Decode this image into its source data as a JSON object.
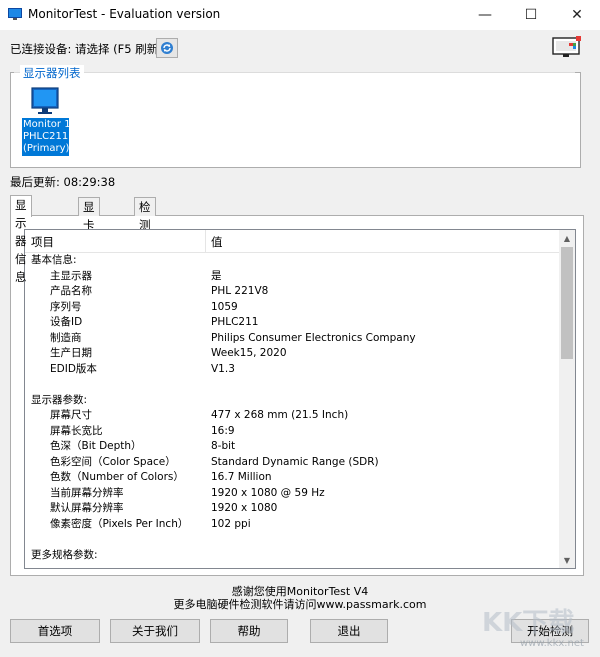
{
  "window": {
    "title": "MonitorTest - Evaluation version",
    "minimize_glyph": "—",
    "maximize_glyph": "☐",
    "close_glyph": "✕"
  },
  "status": {
    "connected_device_text": "已连接设备: 请选择 (F5 刷新)",
    "last_update_label": "最后更新:",
    "last_update_time": "08:29:38"
  },
  "monitor_list": {
    "legend": "显示器列表",
    "monitor": {
      "name": "Monitor 1",
      "model": "PHLC211",
      "role": "(Primary)"
    }
  },
  "tabs": [
    {
      "label": "显示器信息",
      "active": true
    },
    {
      "label": "显卡信息",
      "active": false
    },
    {
      "label": "检测选项",
      "active": false
    }
  ],
  "table": {
    "col_item": "项目",
    "col_value": "值",
    "rows": [
      {
        "k": "基本信息:",
        "v": "",
        "section": true
      },
      {
        "k": "主显示器",
        "v": "是"
      },
      {
        "k": "产品名称",
        "v": "PHL 221V8"
      },
      {
        "k": "序列号",
        "v": "1059"
      },
      {
        "k": "设备ID",
        "v": "PHLC211"
      },
      {
        "k": "制造商",
        "v": "Philips Consumer Electronics Company"
      },
      {
        "k": "生产日期",
        "v": "Week15, 2020"
      },
      {
        "k": "EDID版本",
        "v": "V1.3"
      },
      {
        "k": "",
        "v": ""
      },
      {
        "k": "显示器参数:",
        "v": "",
        "section": true
      },
      {
        "k": "屏幕尺寸",
        "v": "477 x 268 mm (21.5 Inch)"
      },
      {
        "k": "屏幕长宽比",
        "v": "16:9"
      },
      {
        "k": "色深（Bit Depth）",
        "v": "8-bit"
      },
      {
        "k": "色彩空间（Color Space）",
        "v": "Standard Dynamic Range (SDR)"
      },
      {
        "k": "色数（Number of Colors）",
        "v": "16.7 Million"
      },
      {
        "k": "当前屏幕分辨率",
        "v": "1920 x 1080 @ 59 Hz"
      },
      {
        "k": "默认屏幕分辨率",
        "v": "1920 x 1080"
      },
      {
        "k": "像素密度（Pixels Per Inch）",
        "v": "102 ppi"
      },
      {
        "k": "",
        "v": ""
      },
      {
        "k": "更多规格参数:",
        "v": "",
        "section": true
      }
    ]
  },
  "footer": {
    "thanks": "感谢您使用MonitorTest V4",
    "more": "更多电脑硬件检测软件请访问www.passmark.com"
  },
  "buttons": {
    "preferences": "首选项",
    "about": "关于我们",
    "help": "帮助",
    "exit": "退出",
    "start": "开始检测"
  },
  "watermark": {
    "text": "KK下载",
    "url": "www.kkx.net"
  },
  "colors": {
    "accent": "#0078d7",
    "legend": "#0066cc"
  }
}
